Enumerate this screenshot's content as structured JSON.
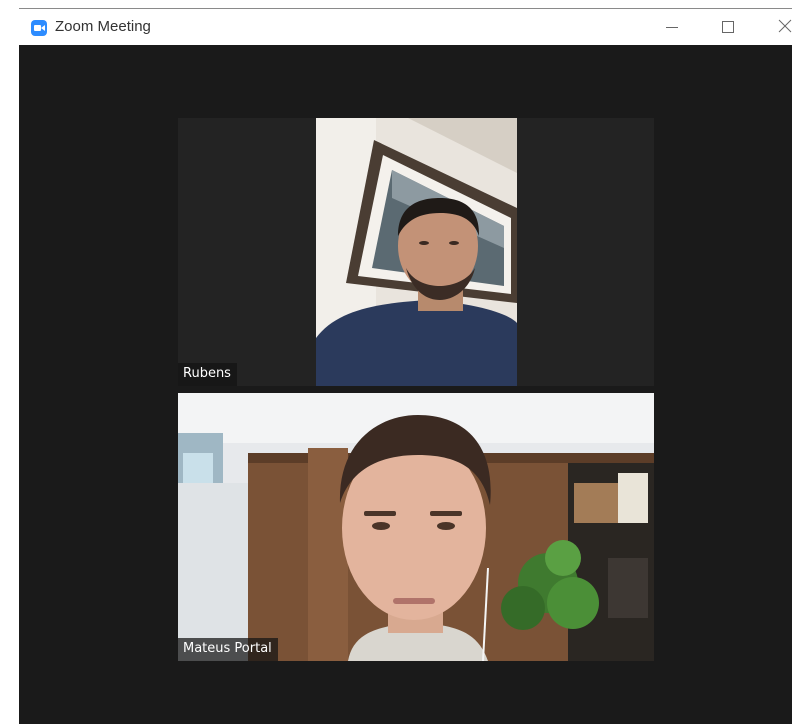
{
  "window": {
    "title": "Zoom Meeting",
    "controls": [
      "minimize",
      "maximize",
      "close"
    ]
  },
  "participants": [
    {
      "name": "Rubens",
      "video": "on",
      "icon": "person-video"
    },
    {
      "name": "Mateus Portal",
      "video": "on",
      "icon": "person-video"
    }
  ],
  "colors": {
    "background": "#1a1a1a",
    "tile": "#232323",
    "accent": "#2d8cff"
  }
}
